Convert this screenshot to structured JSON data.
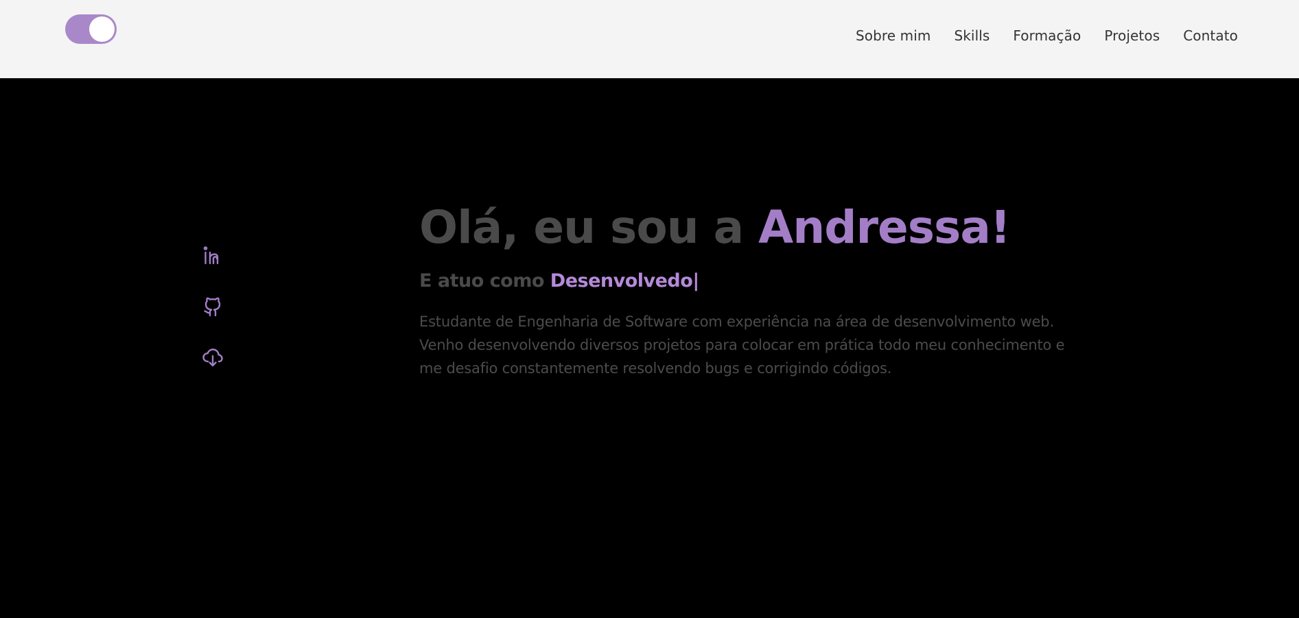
{
  "colors": {
    "header_bg": "#f4f4f4",
    "page_bg": "#000000",
    "accent": "#a37ec7",
    "accent_light": "#b58ad9",
    "muted_text": "#4a4a4a",
    "nav_text": "#333333"
  },
  "header": {
    "theme_toggle": {
      "state": "on",
      "icon": "toggle-switch"
    },
    "nav": [
      {
        "label": "Sobre mim"
      },
      {
        "label": "Skills"
      },
      {
        "label": "Formação"
      },
      {
        "label": "Projetos"
      },
      {
        "label": "Contato"
      }
    ]
  },
  "social": [
    {
      "icon": "linkedin-icon"
    },
    {
      "icon": "github-icon"
    },
    {
      "icon": "cloud-download-icon"
    }
  ],
  "hero": {
    "greeting": "Olá, eu sou a ",
    "name": "Andressa!",
    "role_prefix": "E atuo como ",
    "role": "Desenvolvedo",
    "cursor": "|",
    "description": "Estudante de Engenharia de Software com experiência na área de desenvolvimento web. Venho desenvolvendo diversos projetos para colocar em prática todo meu conhecimento e me desafio constantemente resolvendo bugs e corrigindo códigos."
  }
}
